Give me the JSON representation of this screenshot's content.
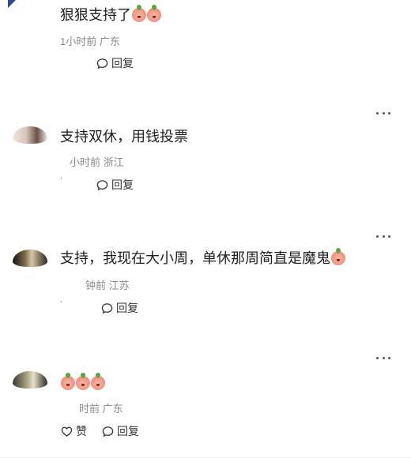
{
  "comments": [
    {
      "text": "狠狠支持了",
      "emoji_count": 2,
      "meta": "1小时前 广东",
      "reply_label": "回复"
    },
    {
      "text": "支持双休，用钱投票",
      "emoji_count": 0,
      "meta": "小时前 浙江",
      "reply_label": "回复"
    },
    {
      "text": "支持，我现在大小周，单休那周简直是魔鬼",
      "emoji_count": 1,
      "meta": "钟前 江苏",
      "reply_label": "回复"
    },
    {
      "text": "",
      "emoji_count": 3,
      "meta": "时前 广东",
      "like_label": "赞",
      "reply_label": "回复"
    }
  ],
  "icons": {
    "reply": "comment-bubble-icon",
    "like": "heart-outline-icon",
    "more": "more-dots-icon",
    "emoji": "peach-emoji-icon"
  },
  "colors": {
    "text": "#1f1f1f",
    "meta": "#8a8a8a",
    "emoji": "#f08d7c",
    "avatar_top": "#2c4b8a"
  }
}
